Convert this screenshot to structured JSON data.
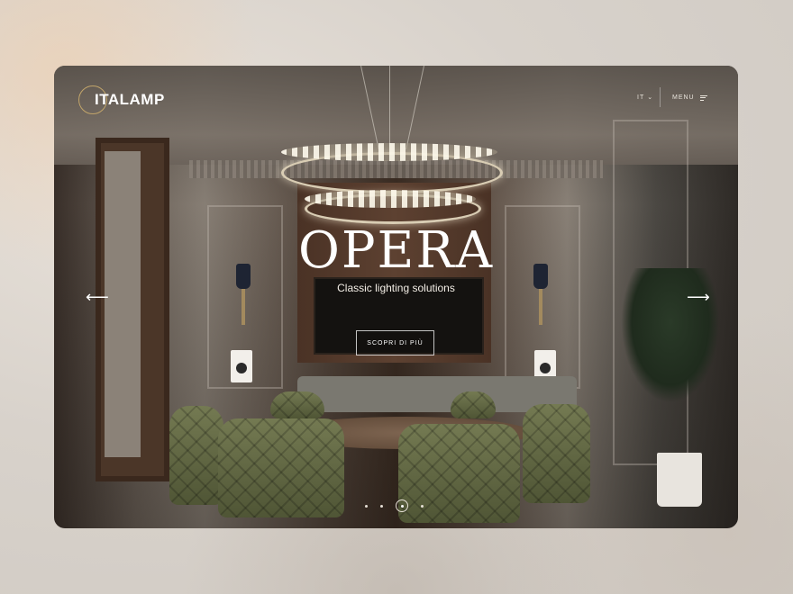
{
  "brand": {
    "name": "ITALAMP",
    "accent": "#c2a56a"
  },
  "header": {
    "language": "IT",
    "menu_label": "MENU"
  },
  "hero": {
    "title": "OPERA",
    "subtitle": "Classic lighting solutions",
    "cta_label": "SCOPRI DI PIÙ"
  },
  "carousel": {
    "prev_icon": "arrow-left-icon",
    "next_icon": "arrow-right-icon",
    "slides": 4,
    "active_slide": 3
  }
}
